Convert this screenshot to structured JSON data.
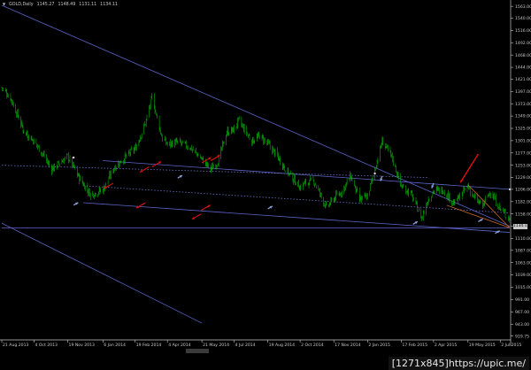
{
  "header": {
    "symbol": "GOLD,Daily",
    "open": "1145.27",
    "high": "1148.49",
    "low": "1131.11",
    "close": "1134.11"
  },
  "watermark": "[1271x845]https://upic.me/",
  "current_price": "1134.11",
  "colors": {
    "background": "#000000",
    "candle": "#00c000",
    "trendline": "#5c64c8",
    "dotted_line": "#6a72c8",
    "signal_arrow": "#e01010",
    "marker_arrow": "#8aa0d8",
    "wedge": "#c86428",
    "axis_text": "#c8c8c8"
  },
  "chart_data": {
    "type": "line",
    "title": "GOLD,Daily",
    "xlabel": "",
    "ylabel": "",
    "ylim": [
      915.75,
      1565.0
    ],
    "x_tick_labels": [
      "21 Aug 2013",
      "4 Oct 2013",
      "19 Nov 2013",
      "6 Jan 2014",
      "19 Feb 2014",
      "4 Apr 2014",
      "21 May 2014",
      "4 Jul 2014",
      "19 Aug 2014",
      "2 Oct 2014",
      "17 Nov 2014",
      "2 Jan 2015",
      "17 Feb 2015",
      "2 Apr 2015",
      "19 May 2015",
      "2 Jul 2015"
    ],
    "y_ticks": [
      1563.0,
      1540.0,
      1516.0,
      1492.0,
      1468.0,
      1444.0,
      1421.0,
      1397.0,
      1373.0,
      1349.0,
      1325.0,
      1301.0,
      1277.0,
      1253.0,
      1229.0,
      1206.0,
      1182.0,
      1158.0,
      1134.0,
      1110.0,
      1087.0,
      1063.0,
      1039.0,
      1015.0,
      991.0,
      967.0,
      943.0,
      919.75
    ],
    "y_tick_labels": [
      "1563.00",
      "1540.00",
      "1516.00",
      "1492.00",
      "1468.00",
      "1444.00",
      "1421.00",
      "1397.00",
      "1373.00",
      "1349.00",
      "1325.00",
      "1301.00",
      "1277.00",
      "1253.00",
      "1229.00",
      "1206.00",
      "1182.00",
      "1158.00",
      "1134.11",
      "1110.00",
      "1087.00",
      "1063.00",
      "1039.00",
      "1015.00",
      "991.00",
      "967.00",
      "943.00",
      "919.75"
    ],
    "x_date_range": [
      "2013-08-21",
      "2015-07-15"
    ],
    "series": [
      {
        "style": "daily-candles",
        "x": [
          "2013-08-21",
          "2013-09-02",
          "2013-09-20",
          "2013-10-04",
          "2013-10-16",
          "2013-10-28",
          "2013-11-19",
          "2013-12-05",
          "2013-12-20",
          "2014-01-06",
          "2014-01-22",
          "2014-02-05",
          "2014-02-19",
          "2014-03-05",
          "2014-03-14",
          "2014-03-28",
          "2014-04-04",
          "2014-04-18",
          "2014-05-05",
          "2014-05-21",
          "2014-06-02",
          "2014-06-12",
          "2014-06-24",
          "2014-07-04",
          "2014-07-10",
          "2014-07-28",
          "2014-08-08",
          "2014-08-19",
          "2014-09-02",
          "2014-09-15",
          "2014-10-02",
          "2014-10-08",
          "2014-10-21",
          "2014-11-07",
          "2014-11-17",
          "2014-11-28",
          "2014-12-10",
          "2014-12-22",
          "2015-01-02",
          "2015-01-12",
          "2015-01-22",
          "2015-02-04",
          "2015-02-17",
          "2015-03-02",
          "2015-03-17",
          "2015-03-25",
          "2015-04-02",
          "2015-04-15",
          "2015-04-30",
          "2015-05-19",
          "2015-05-27",
          "2015-06-08",
          "2015-06-18",
          "2015-07-02",
          "2015-07-15"
        ],
        "y": [
          1405,
          1385,
          1320,
          1300,
          1275,
          1245,
          1270,
          1228,
          1196,
          1205,
          1250,
          1268,
          1285,
          1335,
          1386,
          1305,
          1294,
          1298,
          1288,
          1265,
          1245,
          1260,
          1318,
          1322,
          1340,
          1300,
          1310,
          1295,
          1268,
          1240,
          1210,
          1218,
          1222,
          1170,
          1188,
          1202,
          1232,
          1185,
          1192,
          1245,
          1300,
          1270,
          1212,
          1198,
          1150,
          1185,
          1203,
          1205,
          1178,
          1212,
          1190,
          1173,
          1202,
          1168,
          1148
        ]
      }
    ],
    "trendlines": [
      {
        "name": "upper resistance",
        "style": "solid",
        "from": [
          "2013-08-21",
          1565.0
        ],
        "to": [
          "2015-07-15",
          1134.0
        ]
      },
      {
        "name": "channel top",
        "style": "solid",
        "from": [
          "2014-01-06",
          1262.0
        ],
        "to": [
          "2015-07-15",
          1206.0
        ]
      },
      {
        "name": "channel middle",
        "style": "dotted",
        "from": [
          "2013-12-10",
          1213.0
        ],
        "to": [
          "2015-07-15",
          1160.0
        ]
      },
      {
        "name": "channel bottom",
        "style": "solid",
        "from": [
          "2013-12-10",
          1180.0
        ],
        "to": [
          "2015-07-15",
          1122.0
        ]
      },
      {
        "name": "horizontal support",
        "style": "solid",
        "from": [
          "2013-08-21",
          1131.0
        ],
        "to": [
          "2015-07-15",
          1131.0
        ]
      },
      {
        "name": "upper dotted",
        "style": "dotted",
        "from": [
          "2013-08-21",
          1253.0
        ],
        "to": [
          "2015-03-25",
          1229.0
        ]
      },
      {
        "name": "lower channel",
        "style": "solid",
        "from": [
          "2013-08-21",
          1140.0
        ],
        "to": [
          "2014-05-21",
          945.0
        ]
      }
    ],
    "signal_arrows": [
      {
        "date": "2014-03-14",
        "price": 1250,
        "direction": "up"
      },
      {
        "date": "2014-03-10",
        "price": 1250,
        "direction": "down"
      },
      {
        "date": "2014-01-20",
        "price": 1218,
        "direction": "down"
      },
      {
        "date": "2014-03-05",
        "price": 1180,
        "direction": "down"
      },
      {
        "date": "2014-05-21",
        "price": 1258,
        "direction": "up"
      },
      {
        "date": "2014-06-02",
        "price": 1262,
        "direction": "up"
      },
      {
        "date": "2014-05-20",
        "price": 1165,
        "direction": "up"
      },
      {
        "date": "2014-05-20",
        "price": 1158,
        "direction": "down"
      },
      {
        "date": "2015-06-02",
        "price": 1275,
        "direction": "down"
      }
    ]
  }
}
